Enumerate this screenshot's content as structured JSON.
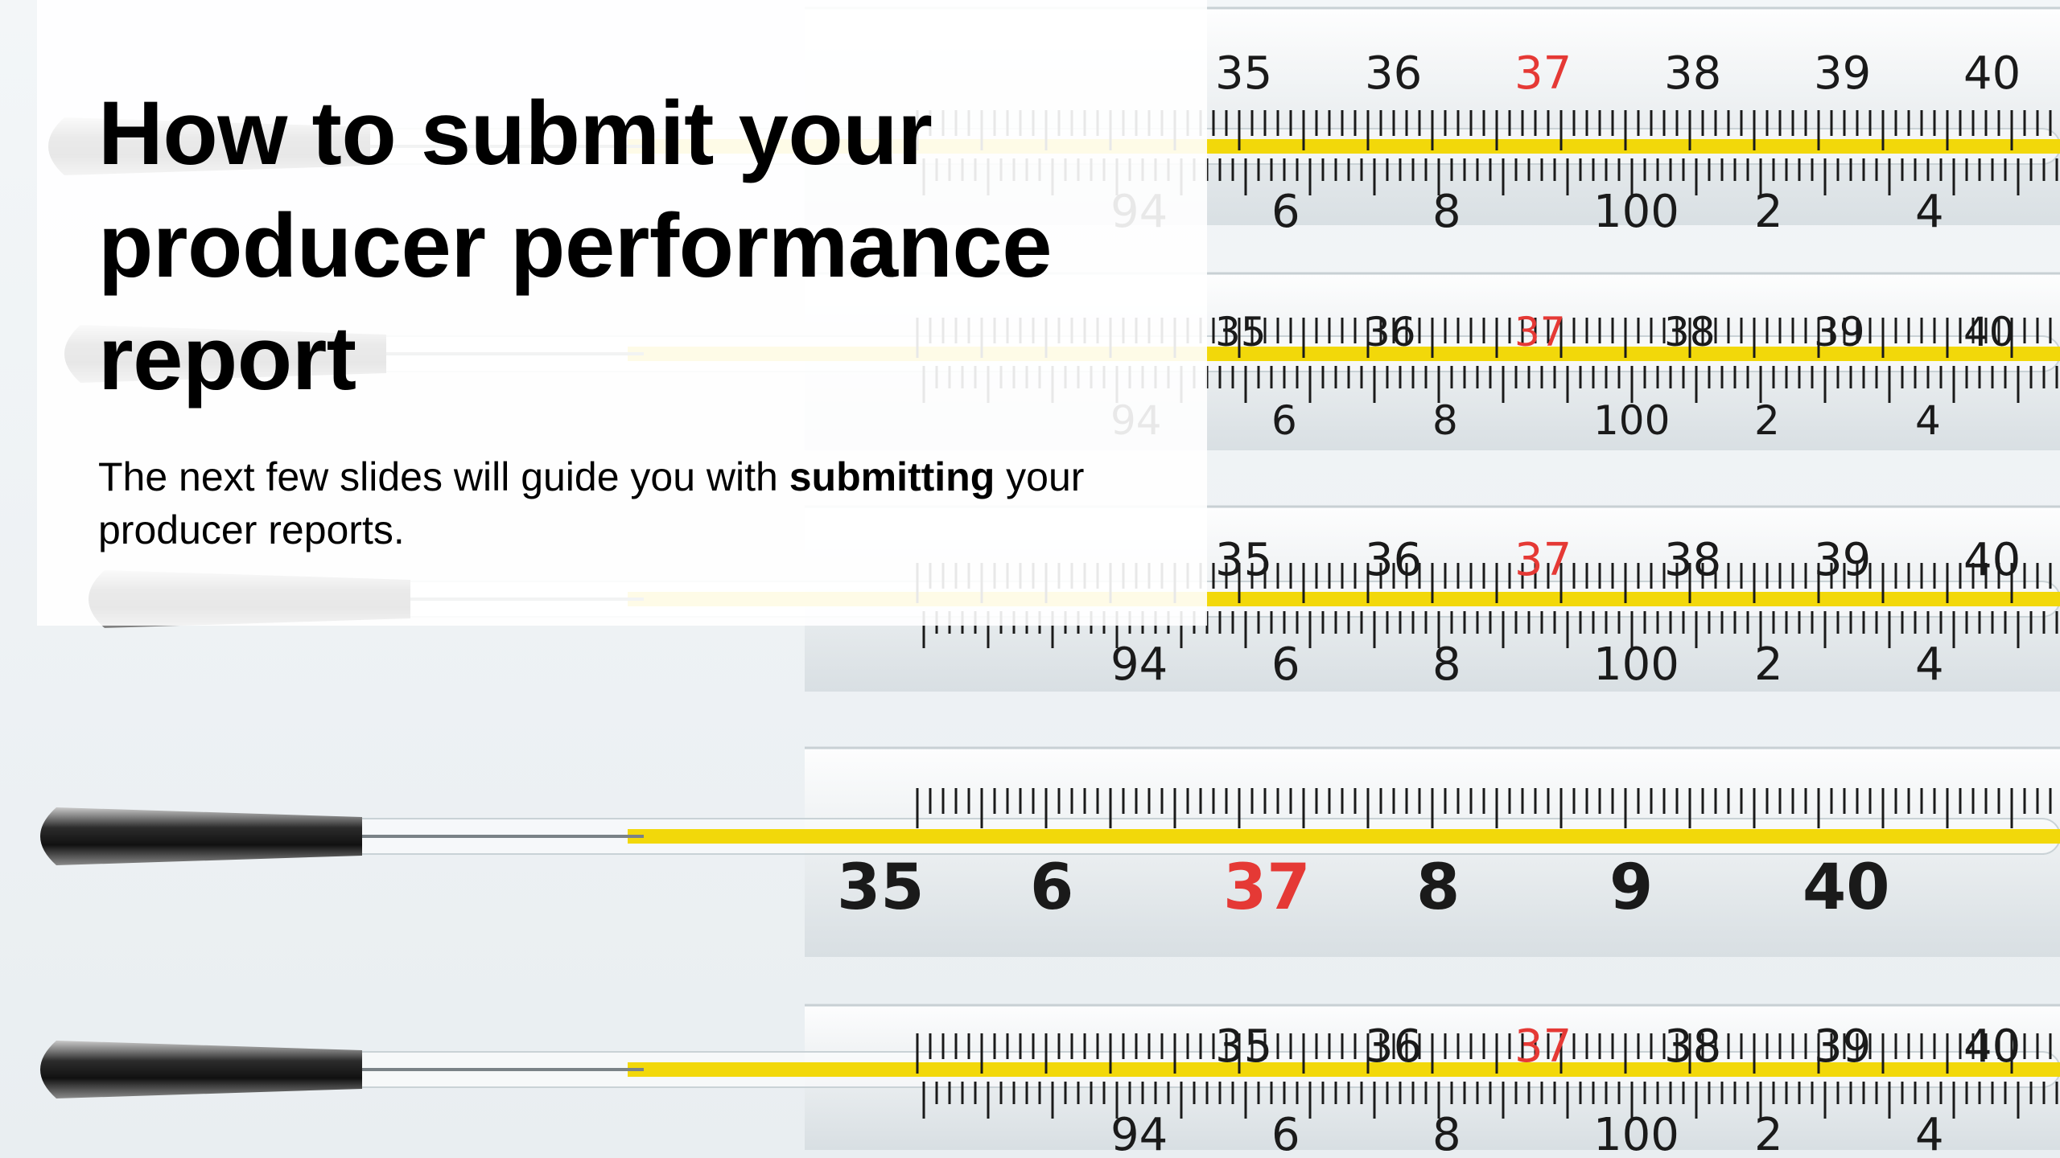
{
  "slide": {
    "title": "How to submit your producer performance report",
    "subtitle_before": "The next few slides will guide you with ",
    "subtitle_bold": "submitting",
    "subtitle_after": " your producer reports."
  },
  "background": {
    "image_subject": "glass clinical thermometers",
    "colors": {
      "mercury": "#f2d80a",
      "tip": "#2a2a2a",
      "scale_text": "#1a1a1a",
      "highlight_text": "#e53935"
    },
    "thermometers": [
      {
        "celsius_labels": [
          "35",
          "36",
          "37",
          "38",
          "39",
          "40"
        ],
        "fahrenheit_labels": [
          "94",
          "6",
          "8",
          "100",
          "2",
          "4"
        ]
      },
      {
        "celsius_labels": [
          "35",
          "36",
          "37",
          "38",
          "39",
          "40"
        ],
        "fahrenheit_labels": [
          "94",
          "6",
          "8",
          "100",
          "2",
          "4"
        ]
      },
      {
        "celsius_labels": [
          "35",
          "36",
          "37",
          "38",
          "39",
          "40"
        ],
        "fahrenheit_labels": [
          "94",
          "6",
          "8",
          "100",
          "2",
          "4"
        ]
      },
      {
        "celsius_labels": [
          "35",
          "6",
          "37",
          "8",
          "9",
          "40"
        ]
      },
      {
        "celsius_labels": [
          "35",
          "36",
          "37",
          "38",
          "39",
          "40"
        ],
        "fahrenheit_labels": [
          "94",
          "6",
          "8",
          "100",
          "2",
          "4"
        ]
      }
    ]
  }
}
